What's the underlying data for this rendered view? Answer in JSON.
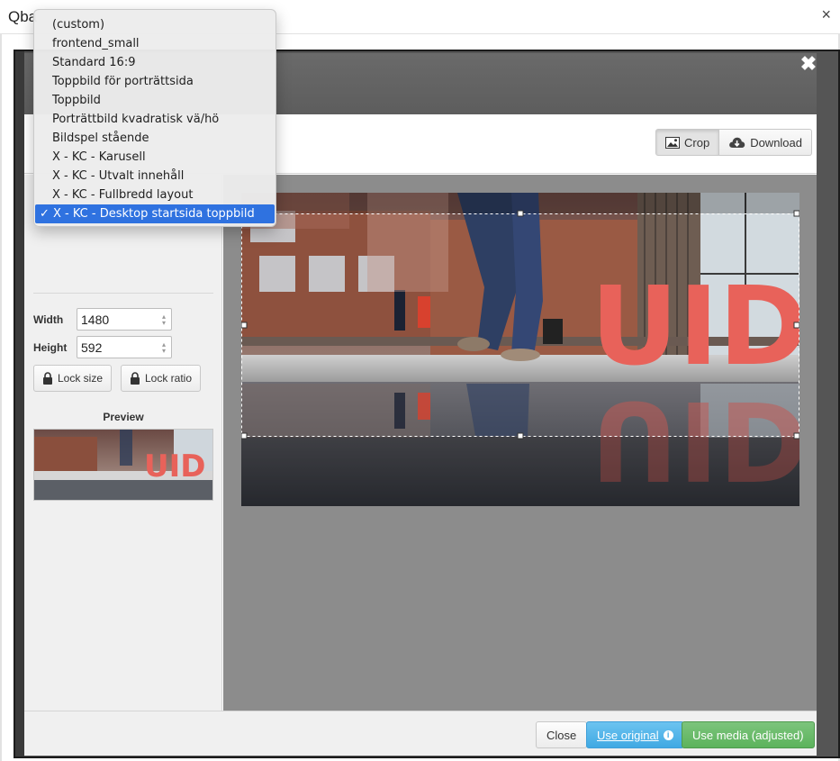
{
  "outer": {
    "title": "Qba",
    "close_glyph": "×"
  },
  "modal": {
    "close_glyph": "✖"
  },
  "toolbar": {
    "crop_label": "Crop",
    "download_label": "Download"
  },
  "size": {
    "width_label": "Width",
    "width_value": "1480",
    "height_label": "Height",
    "height_value": "592",
    "lock_size_label": "Lock size",
    "lock_ratio_label": "Lock ratio",
    "preview_label": "Preview"
  },
  "image": {
    "text": "UID",
    "letter_color": "#e8625a"
  },
  "footer": {
    "close_label": "Close",
    "use_original_label": "Use original",
    "info_glyph": "i",
    "use_media_label": "Use media (adjusted)"
  },
  "preset_menu": {
    "check_glyph": "✓",
    "items": [
      "(custom)",
      "frontend_small",
      "Standard 16:9",
      "Toppbild för porträttsida",
      "Toppbild",
      "Porträttbild kvadratisk vä/hö",
      "Bildspel stående",
      "X - KC - Karusell",
      "X - KC - Utvalt innehåll",
      "X - KC - Fullbredd layout",
      "X - KC - Desktop startsida toppbild"
    ],
    "selected_index": 10
  },
  "colors": {
    "selected_bg": "#2f72e0",
    "primary_blue": "#40a9e3",
    "success_green": "#5cb35c"
  }
}
